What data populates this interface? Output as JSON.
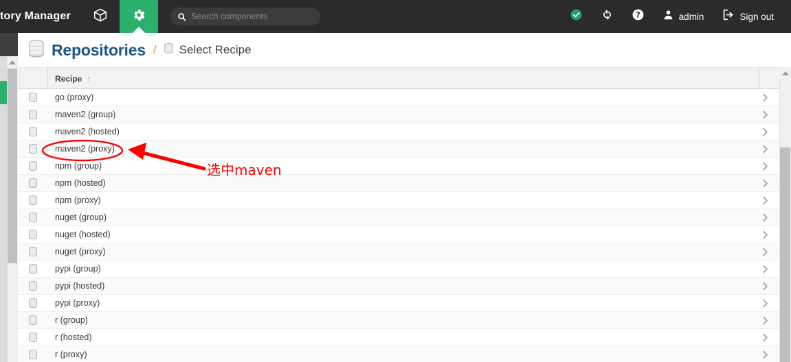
{
  "header": {
    "brand": "tory Manager",
    "nav": [
      {
        "name": "browse-cube-icon",
        "icon": "cube-icon",
        "active": false
      },
      {
        "name": "admin-gear-icon",
        "icon": "gear-icon",
        "active": true
      }
    ],
    "search": {
      "placeholder": "Search components",
      "value": "",
      "icon": "search-icon"
    },
    "right_items": [
      {
        "icon": "check-circle-icon",
        "label": "",
        "name": "health-status-icon",
        "color": "#2ab06f"
      },
      {
        "icon": "refresh-icon",
        "label": "",
        "name": "refresh-icon"
      },
      {
        "icon": "help-icon",
        "label": "",
        "name": "help-icon"
      },
      {
        "icon": "user-icon",
        "label": "admin",
        "name": "user-menu"
      },
      {
        "icon": "sign-out-icon",
        "label": "Sign out",
        "name": "sign-out-button"
      }
    ]
  },
  "breadcrumb": {
    "root_icon": "database-icon",
    "root": "Repositories",
    "separator": "/",
    "leaf_icon": "database-icon",
    "leaf": "Select Recipe"
  },
  "table": {
    "columns": [
      {
        "key": "icon",
        "label": ""
      },
      {
        "key": "recipe",
        "label": "Recipe",
        "sorted": "asc",
        "sort_glyph": "↑"
      },
      {
        "key": "chevron",
        "label": ""
      }
    ],
    "row_icon": "database-icon",
    "row_chevron": "chevron-right-icon",
    "rows": [
      {
        "recipe": "go (proxy)"
      },
      {
        "recipe": "maven2 (group)"
      },
      {
        "recipe": "maven2 (hosted)"
      },
      {
        "recipe": "maven2 (proxy)"
      },
      {
        "recipe": "npm (group)"
      },
      {
        "recipe": "npm (hosted)"
      },
      {
        "recipe": "npm (proxy)"
      },
      {
        "recipe": "nuget (group)"
      },
      {
        "recipe": "nuget (hosted)"
      },
      {
        "recipe": "nuget (proxy)"
      },
      {
        "recipe": "pypi (group)"
      },
      {
        "recipe": "pypi (hosted)"
      },
      {
        "recipe": "pypi (proxy)"
      },
      {
        "recipe": "r (group)"
      },
      {
        "recipe": "r (hosted)"
      },
      {
        "recipe": "r (proxy)"
      }
    ]
  },
  "annotation": {
    "text": "选中maven",
    "color": "#ff0000",
    "highlight_target": "maven2 (proxy)"
  },
  "colors": {
    "header_bg": "#2b2b2b",
    "accent_green": "#2ab06f",
    "link_blue": "#1a5787",
    "annotation_red": "#ff0000"
  }
}
